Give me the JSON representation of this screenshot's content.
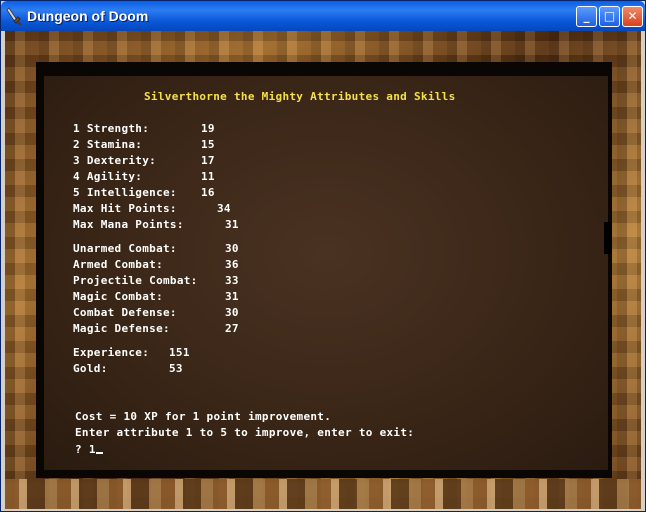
{
  "window": {
    "title": "Dungeon of Doom",
    "min_glyph": "_",
    "max_glyph": "□",
    "close_glyph": "✕"
  },
  "screen": {
    "heading": "Silverthorne the Mighty Attributes and Skills",
    "attributes": [
      {
        "label": "1 Strength:",
        "value": "19"
      },
      {
        "label": "2 Stamina:",
        "value": "15"
      },
      {
        "label": "3 Dexterity:",
        "value": "17"
      },
      {
        "label": "4 Agility:",
        "value": "11"
      },
      {
        "label": "5 Intelligence:",
        "value": "16"
      }
    ],
    "points": [
      {
        "label": "Max Hit Points:",
        "value": "34"
      },
      {
        "label": "Max Mana Points:",
        "value": "31"
      }
    ],
    "skills": [
      {
        "label": "Unarmed Combat:",
        "value": "30"
      },
      {
        "label": "Armed Combat:",
        "value": "36"
      },
      {
        "label": "Projectile Combat:",
        "value": "33"
      },
      {
        "label": "Magic Combat:",
        "value": "31"
      },
      {
        "label": "Combat Defense:",
        "value": "30"
      },
      {
        "label": "Magic Defense:",
        "value": "27"
      }
    ],
    "experience": {
      "label": "Experience:",
      "value": "151"
    },
    "gold": {
      "label": "Gold:",
      "value": "53"
    },
    "cost_line": "Cost = 10 XP for 1 point improvement.",
    "instruction_line": "Enter attribute 1 to 5 to improve, enter to exit:",
    "prompt_symbol": "?",
    "prompt_input": "1"
  }
}
